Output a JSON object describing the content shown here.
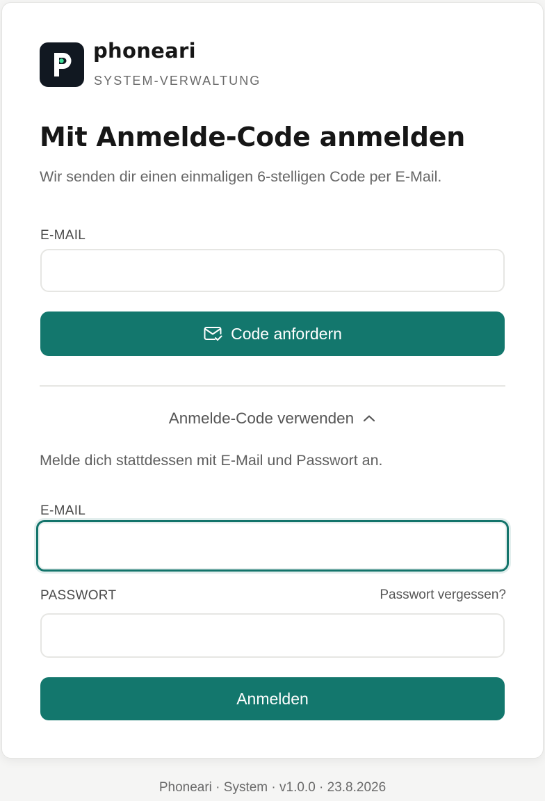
{
  "brand": {
    "name": "phoneari",
    "subtitle": "SYSTEM-VERWALTUNG"
  },
  "title": "Mit Anmelde-Code anmelden",
  "subtitle": "Wir senden dir einen einmaligen 6-stelligen Code per E-Mail.",
  "code_form": {
    "email_label": "E-MAIL",
    "email_value": "",
    "email_placeholder": "",
    "submit_label": "Code anfordern",
    "submit_icon": "mail-check-icon"
  },
  "toggle": {
    "label": "Anmelde-Code verwenden",
    "icon": "chevron-up-icon"
  },
  "password_form": {
    "hint": "Melde dich stattdessen mit E-Mail und Passwort an.",
    "email_label": "E-MAIL",
    "email_value": "",
    "password_label": "PASSWORT",
    "password_value": "",
    "forgot_link": "Passwort vergessen?",
    "submit_label": "Anmelden"
  },
  "footer": "Phoneari · System · v1.0.0 · 23.8.2026",
  "colors": {
    "accent": "#13776d",
    "logo_bg": "#111821",
    "logo_dot": "#3ddc97"
  }
}
